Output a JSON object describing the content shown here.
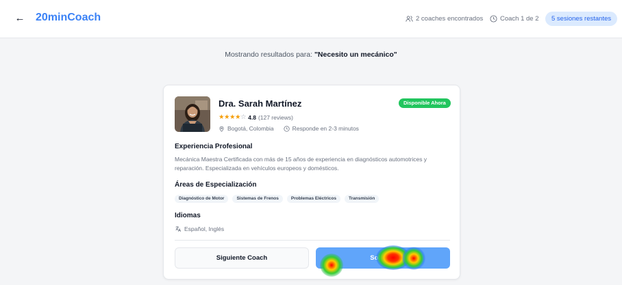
{
  "header": {
    "back_icon": "arrow-left-icon",
    "brand": "20minCoach",
    "coaches_found": "2 coaches encontrados",
    "coach_position": "Coach 1 de 2",
    "sessions_remaining": "5 sesiones restantes"
  },
  "search": {
    "prefix": "Mostrando resultados para:",
    "query": "\"Necesito un mecánico\""
  },
  "coach": {
    "name": "Dra. Sarah Martínez",
    "availability": "Disponible Ahora",
    "rating": 4.8,
    "rating_text": "4.8",
    "reviews": "(127 reviews)",
    "location": "Bogotá, Colombia",
    "response_time": "Responde en 2-3 minutos",
    "experience_title": "Experiencia Profesional",
    "experience_text": "Mecánica Maestra Certificada con más de 15 años de experiencia en diagnósticos automotrices y reparación. Especializada en vehículos europeos y domésticos.",
    "specializations_title": "Áreas de Especialización",
    "specializations": [
      "Diagnóstico de Motor",
      "Sistemas de Frenos",
      "Problemas Eléctricos",
      "Transmisión"
    ],
    "languages_title": "Idiomas",
    "languages": "Español, Inglés"
  },
  "actions": {
    "next_coach": "Siguiente Coach",
    "request": "Solicitar"
  },
  "colors": {
    "brand": "#3b82f6",
    "available": "#22c55e",
    "primary_button": "#60a5fa",
    "star": "#f59e0b"
  }
}
